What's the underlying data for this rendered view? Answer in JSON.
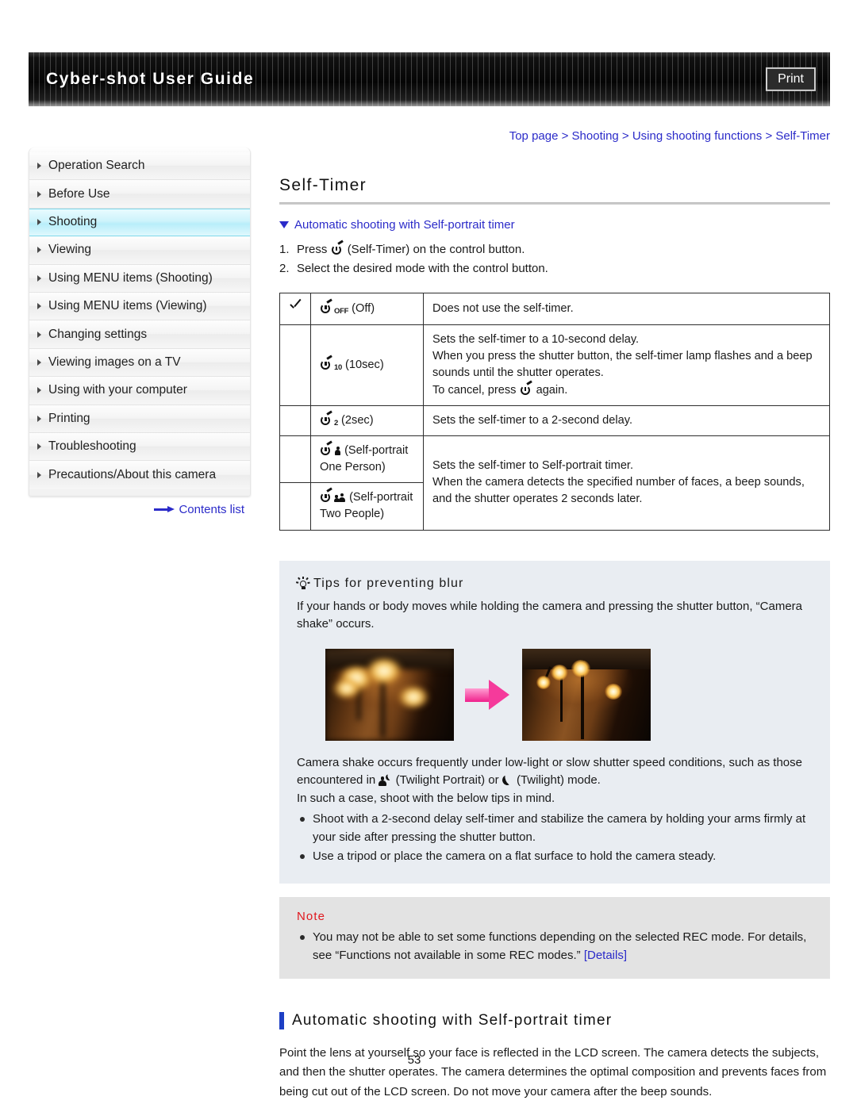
{
  "header": {
    "title": "Cyber-shot User Guide",
    "print_label": "Print"
  },
  "breadcrumb": {
    "text": "Top page > Shooting > Using shooting functions > Self-Timer"
  },
  "sidebar": {
    "items": [
      {
        "label": "Operation Search",
        "active": false
      },
      {
        "label": "Before Use",
        "active": false
      },
      {
        "label": "Shooting",
        "active": true
      },
      {
        "label": "Viewing",
        "active": false
      },
      {
        "label": "Using MENU items (Shooting)",
        "active": false
      },
      {
        "label": "Using MENU items (Viewing)",
        "active": false
      },
      {
        "label": "Changing settings",
        "active": false
      },
      {
        "label": "Viewing images on a TV",
        "active": false
      },
      {
        "label": "Using with your computer",
        "active": false
      },
      {
        "label": "Printing",
        "active": false
      },
      {
        "label": "Troubleshooting",
        "active": false
      },
      {
        "label": "Precautions/About this camera",
        "active": false
      }
    ],
    "contents_link": "Contents list"
  },
  "main": {
    "page_title": "Self-Timer",
    "jump_link": "Automatic shooting with Self-portrait timer",
    "steps": [
      {
        "num": "1.",
        "pre": "Press",
        "icon": "self-timer-icon",
        "post": "(Self-Timer) on the control button."
      },
      {
        "num": "2.",
        "pre": "Select the desired mode with the control button.",
        "icon": "",
        "post": ""
      }
    ],
    "table": {
      "rows": [
        {
          "checked": true,
          "icon": "self-timer-off-icon",
          "sub": "OFF",
          "label": "(Off)",
          "desc_lines": [
            "Does not use the self-timer."
          ]
        },
        {
          "checked": false,
          "icon": "self-timer-10sec-icon",
          "sub": "10",
          "label": "(10sec)",
          "desc_lines": [
            "Sets the self-timer to a 10-second delay.",
            "When you press the shutter button, the self-timer lamp flashes and a beep sounds until the shutter operates.",
            "To cancel, press [icon] again."
          ]
        },
        {
          "checked": false,
          "icon": "self-timer-2sec-icon",
          "sub": "2",
          "label": "(2sec)",
          "desc_lines": [
            "Sets the self-timer to a 2-second delay."
          ]
        },
        {
          "checked": false,
          "icon": "self-portrait-one-person-icon",
          "sub": "",
          "label": "(Self-portrait One Person)",
          "desc_lines": []
        },
        {
          "checked": false,
          "icon": "self-portrait-two-people-icon",
          "sub": "",
          "label": "(Self-portrait Two People)",
          "desc_lines": []
        }
      ],
      "merged_desc": [
        "Sets the self-timer to Self-portrait timer.",
        "When the camera detects the specified number of faces, a beep sounds, and the shutter operates 2 seconds later."
      ],
      "cancel_prefix": "To cancel, press",
      "cancel_suffix": "again."
    },
    "tips": {
      "heading": "Tips for preventing blur",
      "intro": "If your hands or body moves while holding the camera and pressing the shutter button, “Camera shake” occurs.",
      "photo_left_caption": "blurred chandelier photo",
      "photo_right_caption": "sharp chandelier photo",
      "para_a": "Camera shake occurs frequently under low-light or slow shutter speed conditions, such as those encountered in",
      "para_b": "(Twilight Portrait) or",
      "para_c": "(Twilight) mode.",
      "para_d": "In such a case, shoot with the below tips in mind.",
      "bullets": [
        "Shoot with a 2-second delay self-timer and stabilize the camera by holding your arms firmly at your side after pressing the shutter button.",
        "Use a tripod or place the camera on a flat surface to hold the camera steady."
      ]
    },
    "note": {
      "heading": "Note",
      "text_before": "You may not be able to set some functions depending on the selected REC mode. For details, see “Functions not available in some REC modes.”",
      "link": "[Details]"
    },
    "section": {
      "heading": "Automatic shooting with Self-portrait timer",
      "body": "Point the lens at yourself so your face is reflected in the LCD screen. The camera detects the subjects, and then the shutter operates. The camera determines the optimal composition and prevents faces from being cut out of the LCD screen. Do not move your camera after the beep sounds."
    },
    "page_number": "53"
  },
  "colors": {
    "link": "#2b2bc9",
    "note_red": "#e0181e",
    "accent_bar": "#1d3fc4",
    "active_nav": "#b8eefa",
    "arrow_pink": "#f53a9b"
  }
}
